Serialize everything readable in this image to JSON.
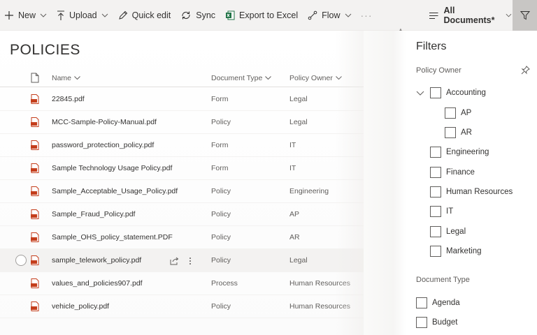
{
  "toolbar": {
    "new_label": "New",
    "upload_label": "Upload",
    "quick_edit_label": "Quick edit",
    "sync_label": "Sync",
    "export_label": "Export to Excel",
    "flow_label": "Flow",
    "more_label": "···",
    "view_label": "All Documents*"
  },
  "page": {
    "title": "POLICIES"
  },
  "columns": {
    "name": "Name",
    "type": "Document Type",
    "owner": "Policy Owner"
  },
  "rows": [
    {
      "name": "22845.pdf",
      "type": "Form",
      "owner": "Legal"
    },
    {
      "name": "MCC-Sample-Policy-Manual.pdf",
      "type": "Policy",
      "owner": "Legal"
    },
    {
      "name": "password_protection_policy.pdf",
      "type": "Form",
      "owner": "IT"
    },
    {
      "name": "Sample Technology Usage Policy.pdf",
      "type": "Form",
      "owner": "IT"
    },
    {
      "name": "Sample_Acceptable_Usage_Policy.pdf",
      "type": "Policy",
      "owner": "Engineering"
    },
    {
      "name": "Sample_Fraud_Policy.pdf",
      "type": "Policy",
      "owner": "AP"
    },
    {
      "name": "Sample_OHS_policy_statement.PDF",
      "type": "Policy",
      "owner": "AR"
    },
    {
      "name": "sample_telework_policy.pdf",
      "type": "Policy",
      "owner": "Legal"
    },
    {
      "name": "values_and_policies907.pdf",
      "type": "Process",
      "owner": "Human Resources"
    },
    {
      "name": "vehicle_policy.pdf",
      "type": "Policy",
      "owner": "Human Resources"
    }
  ],
  "filters": {
    "title": "Filters",
    "policy_owner_label": "Policy Owner",
    "owner_items": {
      "accounting": "Accounting",
      "ap": "AP",
      "ar": "AR",
      "engineering": "Engineering",
      "finance": "Finance",
      "hr": "Human Resources",
      "it": "IT",
      "legal": "Legal",
      "marketing": "Marketing"
    },
    "doc_type_label": "Document Type",
    "type_items": {
      "agenda": "Agenda",
      "budget": "Budget"
    }
  },
  "colors": {
    "toolbar_bg": "#f3f2f1",
    "filter_active_bg": "#c8c6c4",
    "excel_green": "#217346",
    "pdf_red": "#c43e1c",
    "text": "#323130",
    "secondary_text": "#605e5c"
  }
}
